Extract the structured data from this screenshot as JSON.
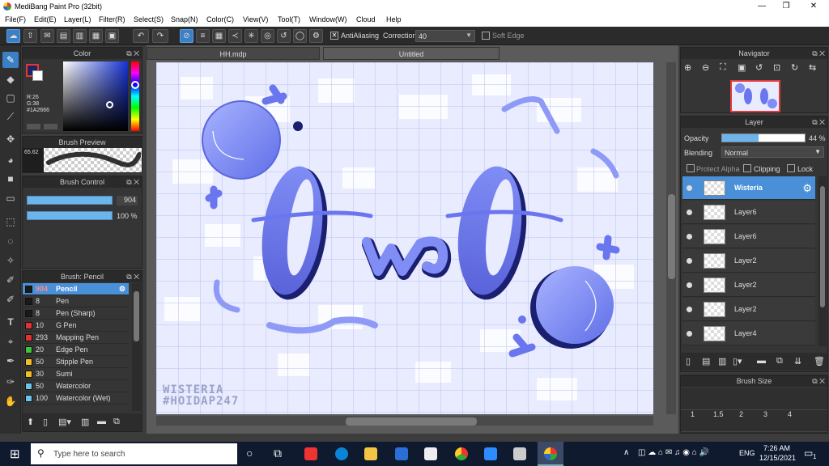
{
  "window": {
    "title": "MediBang Paint Pro (32bit)",
    "min": "—",
    "max": "❐",
    "close": "✕"
  },
  "menu": [
    "File(F)",
    "Edit(E)",
    "Layer(L)",
    "Filter(R)",
    "Select(S)",
    "Snap(N)",
    "Color(C)",
    "View(V)",
    "Tool(T)",
    "Window(W)",
    "Cloud",
    "Help"
  ],
  "toolbar": {
    "antialiasing_label": "AntiAliasing",
    "antialiasing_checked": "✕",
    "correction_label": "Correction",
    "correction_value": "40",
    "softedge_label": "Soft Edge"
  },
  "color_panel": {
    "title": "Color",
    "r": "R:26",
    "g": "G:38",
    "hex": "#1A2666",
    "primary": "#1a2666",
    "secondary": "#ffffff"
  },
  "brush_preview": {
    "title": "Brush Preview",
    "size": "65.62"
  },
  "brush_control": {
    "title": "Brush Control",
    "size_value": "904",
    "opacity_value": "100 %"
  },
  "brush_list": {
    "title": "Brush: Pencil",
    "items": [
      {
        "size": "904",
        "name": "Pencil",
        "color": "#1a1a1a"
      },
      {
        "size": "8",
        "name": "Pen",
        "color": "#1a1a1a"
      },
      {
        "size": "8",
        "name": "Pen (Sharp)",
        "color": "#1a1a1a"
      },
      {
        "size": "10",
        "name": "G Pen",
        "color": "#e53030"
      },
      {
        "size": "293",
        "name": "Mapping Pen",
        "color": "#e53030"
      },
      {
        "size": "20",
        "name": "Edge Pen",
        "color": "#3cc43c"
      },
      {
        "size": "50",
        "name": "Stipple Pen",
        "color": "#f0c020"
      },
      {
        "size": "30",
        "name": "Sumi",
        "color": "#f0c020"
      },
      {
        "size": "50",
        "name": "Watercolor",
        "color": "#6cc4ee"
      },
      {
        "size": "100",
        "name": "Watercolor (Wet)",
        "color": "#6cc4ee"
      }
    ]
  },
  "tabs": [
    "HH.mdp",
    "Untitled"
  ],
  "artwork": {
    "signature_line1": "WISTERIA",
    "signature_line2": "#HOIDAP247"
  },
  "navigator": {
    "title": "Navigator"
  },
  "layer_panel": {
    "title": "Layer",
    "opacity_label": "Opacity",
    "opacity_value": "44 %",
    "opacity_fraction": 0.44,
    "blending_label": "Blending",
    "blending_value": "Normal",
    "protect_alpha": "Protect Alpha",
    "clipping": "Clipping",
    "lock": "Lock",
    "layers": [
      "Wisteria",
      "Layer6",
      "Layer6",
      "Layer2",
      "Layer2",
      "Layer2",
      "Layer4"
    ]
  },
  "brush_size": {
    "title": "Brush Size",
    "values": [
      "1",
      "1.5",
      "2",
      "3",
      "4"
    ]
  },
  "taskbar": {
    "search_placeholder": "Type here to search",
    "lang": "ENG",
    "time": "7:26 AM",
    "date": "12/15/2021",
    "notif": "1"
  }
}
